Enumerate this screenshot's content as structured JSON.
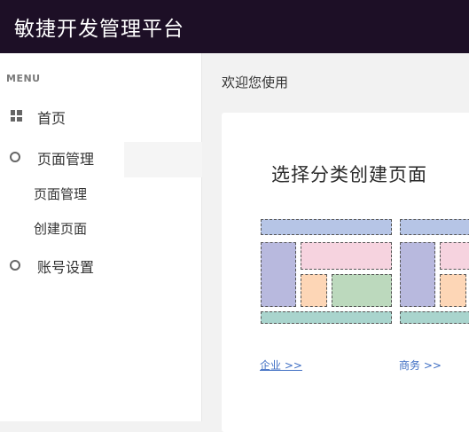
{
  "header": {
    "title": "敏捷开发管理平台"
  },
  "sidebar": {
    "menu_heading": "MENU",
    "items": [
      {
        "label": "首页",
        "icon": "dashboard-icon"
      },
      {
        "label": "页面管理",
        "icon": "circle-icon"
      },
      {
        "label": "账号设置",
        "icon": "circle-icon"
      }
    ],
    "subitems": [
      {
        "label": "页面管理"
      },
      {
        "label": "创建页面"
      }
    ]
  },
  "main": {
    "breadcrumb": "欢迎您使用",
    "card": {
      "title": "选择分类创建页面",
      "categories": [
        {
          "label": "企业 >>"
        },
        {
          "label": "商务 >>"
        }
      ]
    }
  },
  "colors": {
    "topbar": "#1d0f26",
    "link": "#3f6ec3"
  }
}
